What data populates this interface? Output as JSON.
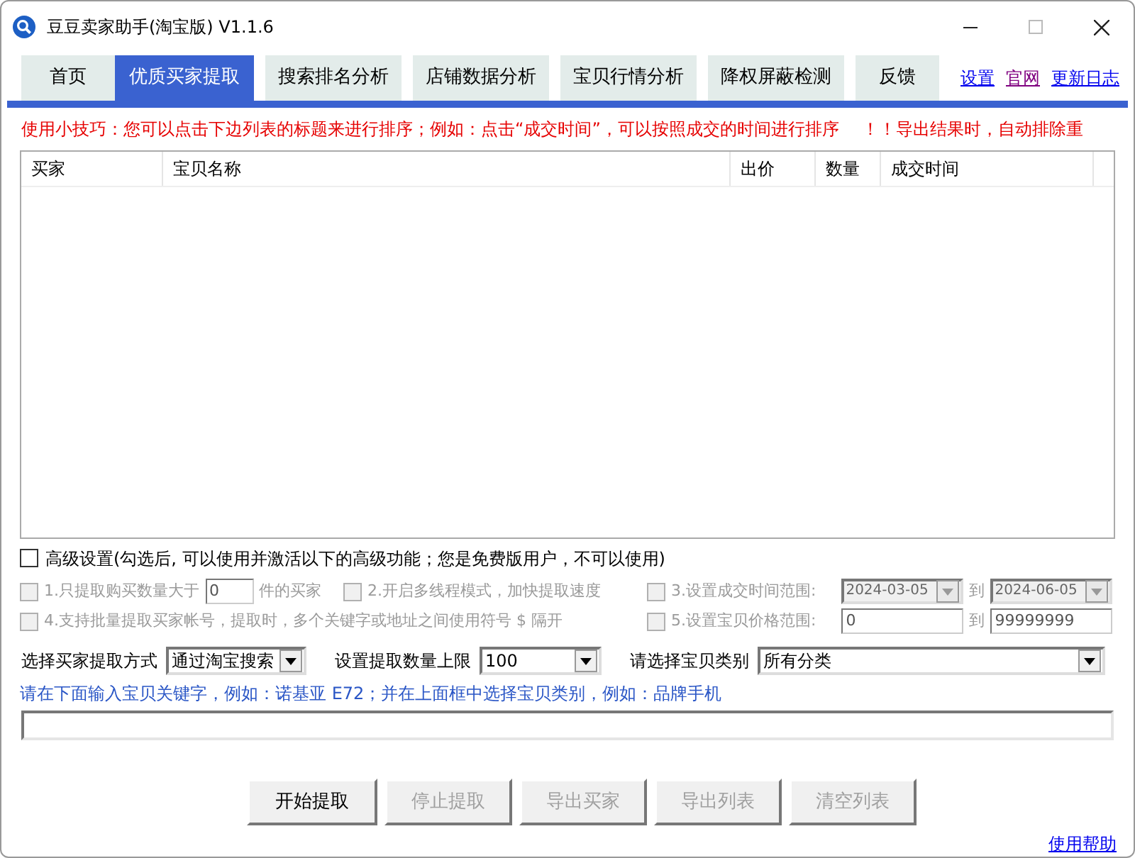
{
  "window": {
    "title": "豆豆卖家助手(淘宝版) V1.1.6"
  },
  "tabs": [
    {
      "label": "首页",
      "selected": false
    },
    {
      "label": "优质买家提取",
      "selected": true
    },
    {
      "label": "搜索排名分析",
      "selected": false
    },
    {
      "label": "店铺数据分析",
      "selected": false
    },
    {
      "label": "宝贝行情分析",
      "selected": false
    },
    {
      "label": "降权屏蔽检测",
      "selected": false
    },
    {
      "label": "反馈",
      "selected": false
    }
  ],
  "links": [
    {
      "label": "设置",
      "visited": false
    },
    {
      "label": "官网",
      "visited": true
    },
    {
      "label": "更新日志",
      "visited": false
    }
  ],
  "tip": "使用小技巧：您可以点击下边列表的标题来进行排序；例如：点击“成交时间”，可以按照成交的时间进行排序",
  "tip_warning": "！！导出结果时，自动排除重",
  "table": {
    "columns": [
      "买家",
      "宝贝名称",
      "出价",
      "数量",
      "成交时间"
    ]
  },
  "advanced": {
    "label": "高级设置(勾选后, 可以使用并激活以下的高级功能；您是免费版用户，不可以使用)",
    "checked": false
  },
  "options": [
    {
      "kind": "count",
      "label": "1.只提取购买数量大于",
      "value": "0",
      "suffix": "件的买家",
      "checked": false,
      "disabled": true
    },
    {
      "kind": "plain",
      "label": "2.开启多线程模式，加快提取速度",
      "checked": false,
      "disabled": true
    },
    {
      "kind": "date_range",
      "label": "3.设置成交时间范围:",
      "from": "2024-03-05",
      "to_label": "到",
      "to": "2024-06-05",
      "checked": false,
      "disabled": true
    },
    {
      "kind": "wide",
      "label": "4.支持批量提取买家帐号，提取时，多个关键字或地址之间使用符号 $ 隔开",
      "checked": false,
      "disabled": true
    },
    {
      "kind": "price_range",
      "label": "5.设置宝贝价格范围:",
      "from": "0",
      "to_label": "到",
      "to": "99999999",
      "checked": false,
      "disabled": true
    }
  ],
  "selects": [
    {
      "label": "选择买家提取方式",
      "value": "通过淘宝搜索"
    },
    {
      "label": "设置提取数量上限",
      "value": "100"
    },
    {
      "label": "请选择宝贝类别",
      "value": "所有分类"
    }
  ],
  "hint": "请在下面输入宝贝关键字，例如：诺基亚 E72；并在上面框中选择宝贝类别，例如：品牌手机",
  "buttons": [
    {
      "label": "开始提取",
      "disabled": false
    },
    {
      "label": "停止提取",
      "disabled": true
    },
    {
      "label": "导出买家",
      "disabled": true
    },
    {
      "label": "导出列表",
      "disabled": true
    },
    {
      "label": "清空列表",
      "disabled": true
    }
  ],
  "help_link": "使用帮助"
}
